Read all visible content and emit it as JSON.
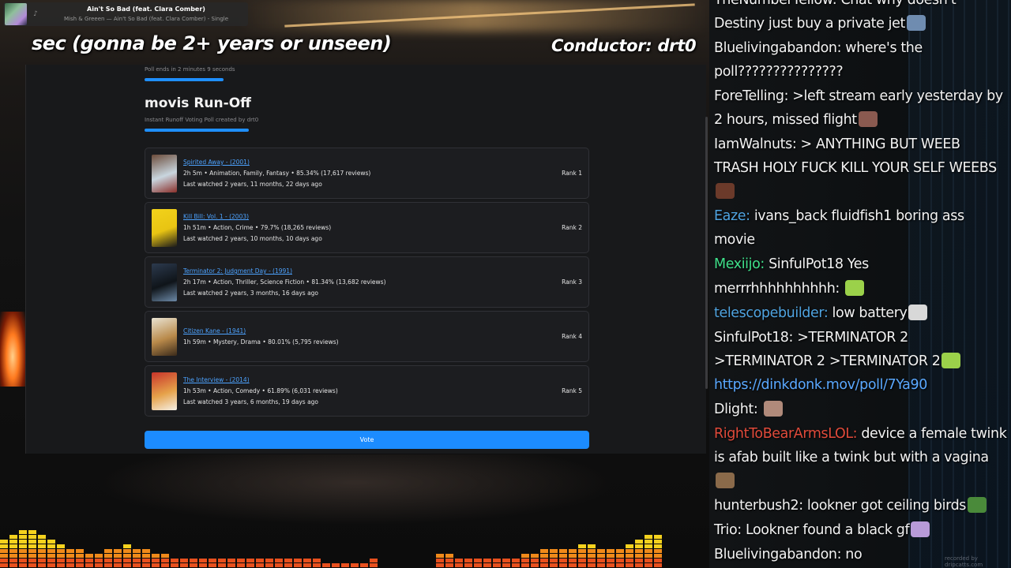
{
  "now_playing": {
    "title": "Ain't So Bad (feat. Clara Comber)",
    "subtitle": "Mish & Greeen — Ain't So Bad (feat. Clara Comber) - Single",
    "icon": "music-icon",
    "accent": "#e03a3a"
  },
  "captions": {
    "left": "sec (gonna be 2+ years or unseen)",
    "right": "Conductor: drt0"
  },
  "poll": {
    "ends": "Poll ends in 2 minutes 9 seconds",
    "title": "movis Run-Off",
    "subtitle": "Instant Runoff Voting Poll created by drt0",
    "accent": "#1f8fff",
    "vote_label": "Vote",
    "movies": [
      {
        "title": "Spirited Away - (2001)",
        "meta": "2h 5m • Animation, Family, Fantasy • 85.34% (17,617 reviews)",
        "last": "Last watched 2 years, 11 months, 22 days ago",
        "rank": "Rank 1",
        "poster_colors": [
          "#6b4b3a",
          "#c9d6df",
          "#8a2f2a"
        ]
      },
      {
        "title": "Kill Bill: Vol. 1 - (2003)",
        "meta": "1h 51m • Action, Crime • 79.7% (18,265 reviews)",
        "last": "Last watched 2 years, 10 months, 10 days ago",
        "rank": "Rank 2",
        "poster_colors": [
          "#f2d21b",
          "#e8c413",
          "#1a1a1a"
        ]
      },
      {
        "title": "Terminator 2: Judgment Day - (1991)",
        "meta": "2h 17m • Action, Thriller, Science Fiction • 81.34% (13,682 reviews)",
        "last": "Last watched 2 years, 3 months, 16 days ago",
        "rank": "Rank 3",
        "poster_colors": [
          "#2c3a4e",
          "#0f1419",
          "#6d8aa8"
        ]
      },
      {
        "title": "Citizen Kane - (1941)",
        "meta": "1h 59m • Mystery, Drama • 80.01% (5,795 reviews)",
        "last": "",
        "rank": "Rank 4",
        "poster_colors": [
          "#e9e3d2",
          "#b98a4a",
          "#3a2a1a"
        ]
      },
      {
        "title": "The Interview - (2014)",
        "meta": "1h 53m • Action, Comedy • 61.89% (6,031 reviews)",
        "last": "Last watched 3 years, 6 months, 19 days ago",
        "rank": "Rank 5",
        "poster_colors": [
          "#c8342a",
          "#e6a24a",
          "#f5f0e6"
        ]
      }
    ]
  },
  "chat": [
    {
      "user": "TheNumberYellow",
      "msg": "Chat why doesn't Destiny just buy a private jet",
      "color": "#f2f2f2",
      "emote": "#6f8cb0"
    },
    {
      "user": "Bluelivingabandon",
      "msg": "where's the poll???????????????",
      "color": "#f2f2f2"
    },
    {
      "user": "ForeTelling",
      "msg": ">left stream early yesterday by 2 hours, missed flight",
      "color": "#f2f2f2",
      "emote": "#8a5a50"
    },
    {
      "user": "IamWalnuts",
      "msg": "> ANYTHING BUT WEEB TRASH HOLY FUCK KILL YOUR SELF WEEBS",
      "color": "#f2f2f2",
      "emote": "#6b3a2a"
    },
    {
      "user": "Eaze",
      "msg": "ivans_back fluidfish1 boring ass movie",
      "color": "#4fa3e0"
    },
    {
      "user": "Mexiijo",
      "msg": "SinfulPot18 Yes",
      "color": "#3fe08a"
    },
    {
      "user": "merrrhhhhhhhhhh",
      "msg": "",
      "color": "#f2f2f2",
      "emote": "#9bd14a"
    },
    {
      "user": "telescopebuilder",
      "msg": "low battery",
      "color": "#4fa3e0",
      "emote": "#d8d8d8"
    },
    {
      "user": "SinfulPot18",
      "msg": ">TERMINATOR 2  >TERMINATOR 2  >TERMINATOR 2",
      "color": "#f2f2f2",
      "emote": "#9bd14a"
    },
    {
      "user": "",
      "msg": "https://dinkdonk.mov/poll/7Ya90",
      "color": "#5aa8ff"
    },
    {
      "user": "Dlight",
      "msg": "",
      "color": "#f2f2f2",
      "emote": "#b08a7a"
    },
    {
      "user": "RightToBearArmsLOL",
      "msg": "device a female twink is afab built like a twink but with a vagina",
      "color": "#e04a3a",
      "emote": "#8a6a4a"
    },
    {
      "user": "hunterbush2",
      "msg": "lookner got ceiling birds",
      "color": "#f2f2f2",
      "emote": "#4a8a3a"
    },
    {
      "user": "Trio",
      "msg": "Lookner found a black gf",
      "color": "#f2f2f2",
      "emote": "#b89ad8"
    },
    {
      "user": "Bluelivingabandon",
      "msg": "no",
      "color": "#f2f2f2"
    }
  ],
  "watermark": "recorded by dripcatts.com"
}
